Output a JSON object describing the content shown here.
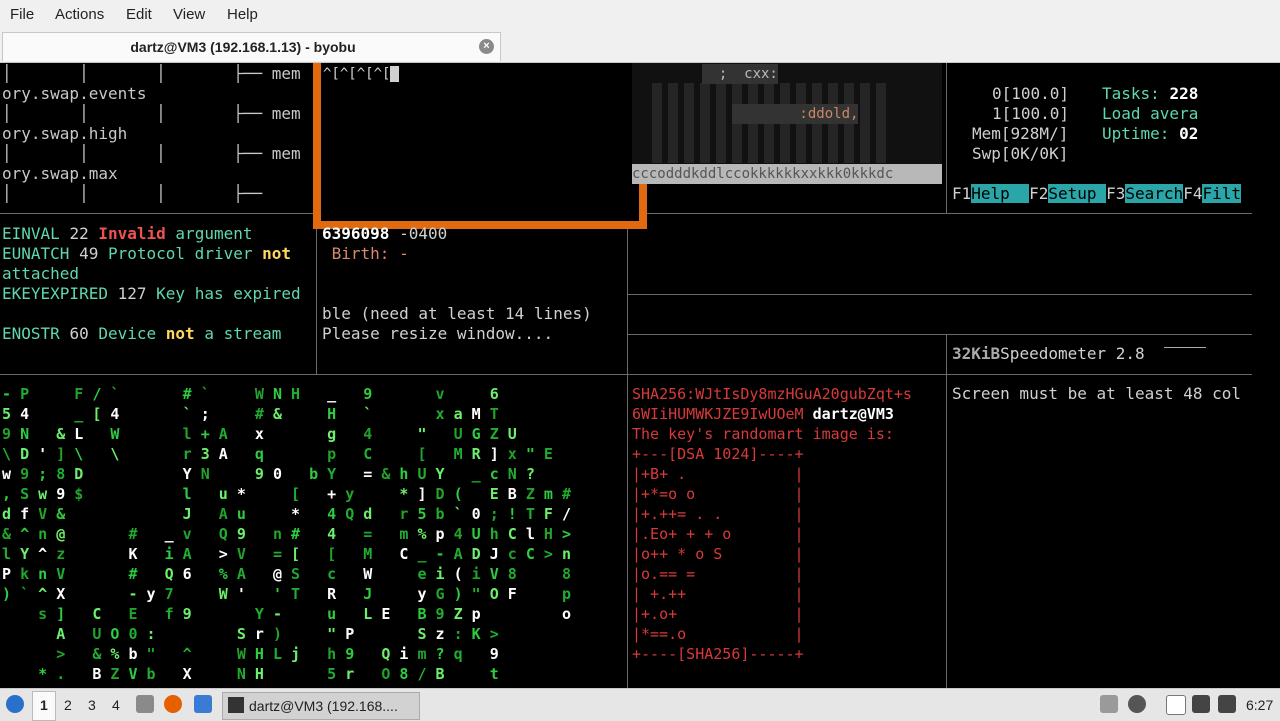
{
  "menu": {
    "file": "File",
    "actions": "Actions",
    "edit": "Edit",
    "view": "View",
    "help": "Help"
  },
  "tab": {
    "title": "dartz@VM3 (192.168.1.13) - byobu",
    "close": "×"
  },
  "tree": {
    "mem1": "│       │       │       ├── mem",
    "l1": "ory.swap.events",
    "mem2": "│       │       │       ├── mem",
    "l2": "ory.swap.high",
    "mem3": "│       │       │       ├── mem",
    "l3": "ory.swap.max",
    "mem4": "│       │       │       ├──"
  },
  "editor": {
    "text": "^[^[^[^["
  },
  "cmatrix_top": {
    "r1": "  ;  cxx:",
    "r2": "        :ddold,",
    "bar": "cccodddkddlccokkkkkkxxkkk0kkkdc"
  },
  "htop": {
    "cpu0": "0[100.0]",
    "cpu1": "1[100.0]",
    "mem": "Mem[928M/]",
    "swp": "Swp[0K/0K]",
    "tasks_label": "Tasks:",
    "tasks_val": "228",
    "load": "Load avera",
    "uptime_label": "Uptime:",
    "uptime_val": "02",
    "f1": "F1",
    "f1l": "Help  ",
    "f2": "F2",
    "f2l": "Setup ",
    "f3": "F3",
    "f3l": "Search",
    "f4": "F4",
    "f4l": "Filt"
  },
  "errno": {
    "e1": "EINVAL",
    "e1n": "22",
    "e1a": "Invalid",
    "e1b": "argument",
    "e2": "EUNATCH",
    "e2n": "49",
    "e2a": "Protocol driver",
    "e2b": "not",
    "e2c": "attached",
    "e3": "EKEYEXPIRED",
    "e3n": "127",
    "e3a": "Key has expired",
    "e4": "ENOSTR",
    "e4n": "60",
    "e4a": "Device",
    "e4b": "not",
    "e4c": "a stream"
  },
  "stat": {
    "line1a": "6396098",
    "line1b": " -0400",
    "birth": " Birth: -"
  },
  "resize": {
    "l1": "ble (need at least 14 lines)",
    "l2": "Please resize window...."
  },
  "speedo": {
    "size": "32KiB",
    "name": "Speedometer 2.8"
  },
  "screen_msg": "Screen must be at least 48 col",
  "sshkey": {
    "fp1": "SHA256:WJtIsDy8mzHGuA20gubZqt+s",
    "fp2": "6WIiHUMWKJZE9IwUOeM",
    "host": " dartz@VM3",
    "intro": "The key's randomart image is:",
    "art": [
      "+---[DSA 1024]----+",
      "|+B+ .            |",
      "|+*=o o           |",
      "|+.++= . .        |",
      "|.Eo+ + + o       |",
      "|o++ * o S        |",
      "|o.== =           |",
      "| +.++            |",
      "|+.o+             |",
      "|*==.o            |",
      "+----[SHA256]-----+"
    ]
  },
  "matrix_rows": [
    "- P     F / `       # `     W N H   _   9       v     6",
    "5 4     _ [ 4       ` ;     # &     H   `       x a M T",
    "9 N   & L   W       l + A   x       g   4     \"   U G Z U",
    "\\ D ' ] \\   \\       r 3 A   q       p   C     [   M R ] x \" E",
    "w 9 ; 8 D           Y N     9 0   b Y   = & h U Y   _ c N ?",
    ", S w 9 $           l   u *     [   + y     * ] D (   E B Z m #",
    "d f V &             J   A u     *   4 Q d   r 5 b ` 0 ; ! T F /",
    "& ^ n @       #   _ v   Q 9   n #   4   =   m % p 4 U h C l H >",
    "l Y ^ z       K   i A   > V   = [   [   M   C _ - A D J c C > n",
    "P k n V       #   Q 6   % A   @ S   c   W     e i ( i V 8     8",
    ") ` ^ X       - y 7     W '   ' T   R   J     y G ) \" O F     p",
    "    s ]   C   E   f 9       Y -     u   L E   B 9 Z p         o",
    "      A   U O 0 :         S r )     \" P       S z : K >",
    "      >   & % b \"   ^     W H L j   h 9   Q i m ? q   9",
    "    * .   B Z V b   X     N H       5 r   O 8 / B     t"
  ],
  "taskbar": {
    "ws1": "1",
    "ws2": "2",
    "ws3": "3",
    "ws4": "4",
    "task": "dartz@VM3 (192.168....",
    "clock": "6:27"
  }
}
